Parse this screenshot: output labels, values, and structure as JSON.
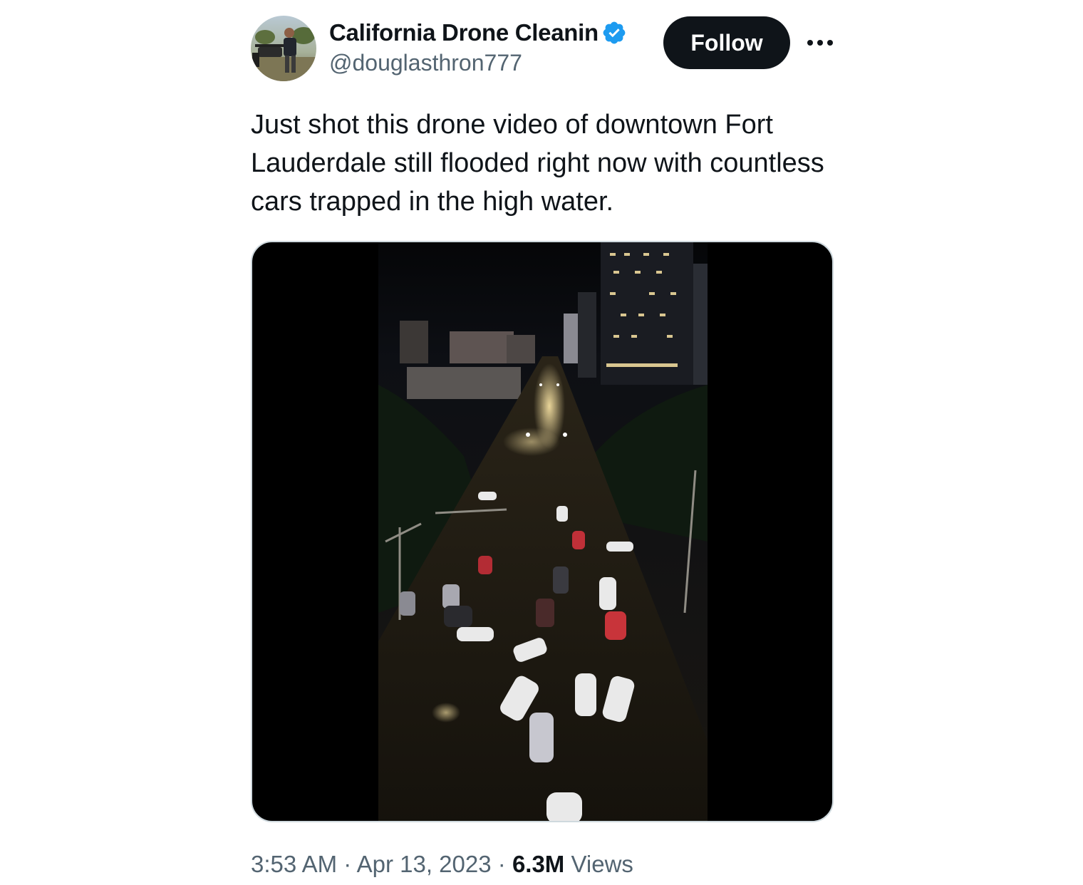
{
  "author": {
    "display_name": "California Drone Cleanin",
    "handle": "@douglasthron777",
    "verified": true,
    "avatar_icon": "drone-pilot-avatar"
  },
  "actions": {
    "follow_label": "Follow",
    "more_icon": "more-dots-icon"
  },
  "tweet": {
    "text": "Just shot this drone video of downtown Fort Lauderdale still flooded right now with countless cars trapped in the high water."
  },
  "media": {
    "type": "video",
    "icon": "video-thumbnail"
  },
  "meta": {
    "time": "3:53 AM",
    "separator": "·",
    "date": "Apr 13, 2023",
    "views_count": "6.3M",
    "views_label": "Views"
  },
  "colors": {
    "text_primary": "#0f1419",
    "text_secondary": "#536471",
    "verified_blue": "#1d9bf0",
    "follow_bg": "#0f1419",
    "border": "#cfd9de"
  }
}
